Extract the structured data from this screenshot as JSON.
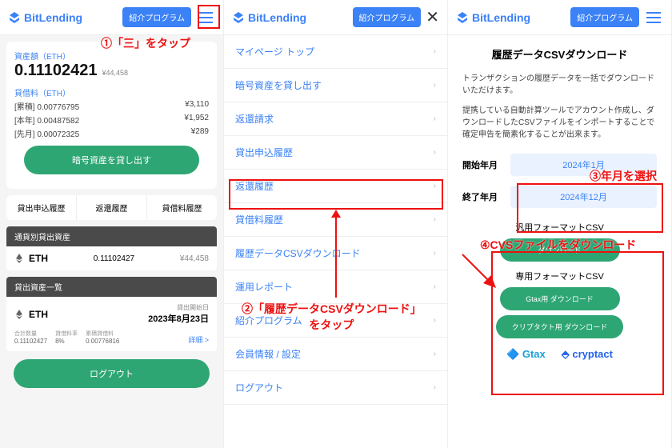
{
  "brand": "BitLending",
  "ref_program": "紹介プログラム",
  "p1": {
    "asset_label": "資産額（ETH）",
    "amount": "0.11102421",
    "jpy": "¥44,458",
    "fee_label": "貸借料（ETH）",
    "r1_l": "[累積] 0.00776795",
    "r1_r": "¥3,110",
    "r2_l": "[本年] 0.00487582",
    "r2_r": "¥1,952",
    "r3_l": "[先月] 0.00072325",
    "r3_r": "¥289",
    "lend": "暗号資産を貸し出す",
    "tab1": "貸出申込履歴",
    "tab2": "返還履歴",
    "tab3": "貸借料履歴",
    "sect1": "通貨別貸出資産",
    "eth": "ETH",
    "eth_amt": "0.11102427",
    "eth_jpy": "¥44,458",
    "sect2": "貸出資産一覧",
    "start_lbl": "貸出開始日",
    "start_date": "2023年8月23日",
    "st_total_l": "合計数量",
    "st_total_v": "0.11102427",
    "st_rate_l": "貸借料率",
    "st_rate_v": "8%",
    "st_acc_l": "累積貸借料",
    "st_acc_v": "0.00776816",
    "detail": "詳細 >",
    "logout": "ログアウト"
  },
  "p2": {
    "m": [
      "マイページ トップ",
      "暗号資産を貸し出す",
      "返還請求",
      "貸出申込履歴",
      "返還履歴",
      "貸借料履歴",
      "履歴データCSVダウンロード",
      "運用レポート",
      "紹介プログラム",
      "会員情報 / 設定",
      "ログアウト"
    ]
  },
  "p3": {
    "title": "履歴データCSVダウンロード",
    "d1": "トランザクションの履歴データを一括でダウンロードいただけます。",
    "d2": "提携している自動計算ツールでアカウント作成し、ダウンロードしたCSVファイルをインポートすることで確定申告を簡素化することが出来ます。",
    "start_lbl": "開始年月",
    "start_val": "2024年1月",
    "end_lbl": "終了年月",
    "end_val": "2024年12月",
    "fmt1": "汎用フォーマットCSV",
    "dl1": "ダウンロード",
    "fmt2": "専用フォーマットCSV",
    "dl2": "Gtax用 ダウンロード",
    "dl3": "クリプタクト用 ダウンロード",
    "g": "Gtax",
    "c": "cryptact"
  },
  "ann": {
    "a1": "①「三」をタップ",
    "a2": "②「履歴データCSVダウンロード」\nをタップ",
    "a3": "③年月を選択",
    "a4": "④CVSファイルをダウンロード"
  }
}
